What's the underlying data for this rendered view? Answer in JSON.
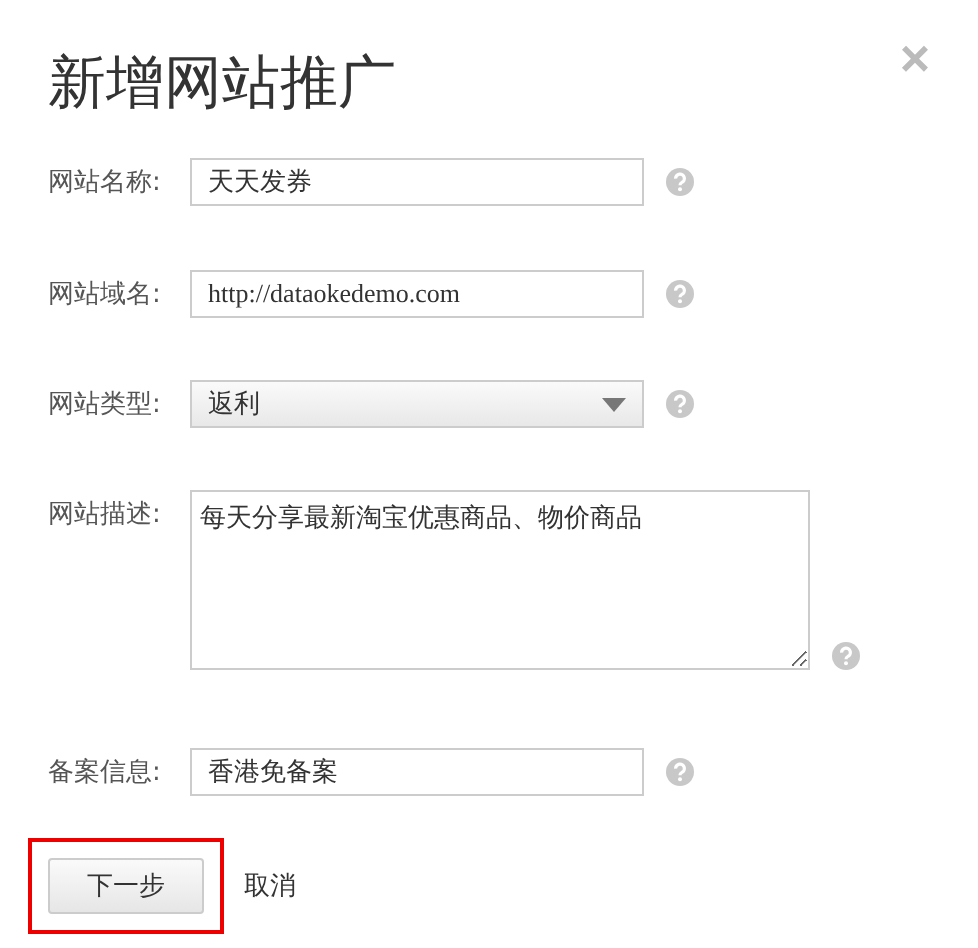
{
  "dialog": {
    "title": "新增网站推广",
    "close": "×"
  },
  "fields": [
    {
      "label": "网站名称:",
      "kind": "text",
      "value": "天天发券"
    },
    {
      "label": "网站域名:",
      "kind": "text",
      "value": "http://dataokedemo.com"
    },
    {
      "label": "网站类型:",
      "kind": "select",
      "value": "返利"
    },
    {
      "label": "网站描述:",
      "kind": "textarea",
      "value": "每天分享最新淘宝优惠商品、物价商品"
    },
    {
      "label": "备案信息:",
      "kind": "text",
      "value": "香港免备案"
    }
  ],
  "actions": {
    "next": {
      "label": "下一步",
      "highlighted": true
    },
    "cancel": "取消"
  }
}
